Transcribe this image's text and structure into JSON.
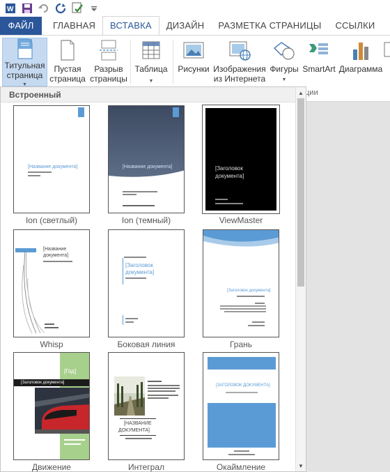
{
  "quick_access": {
    "icons": [
      "word-logo-icon",
      "save-icon",
      "undo-icon",
      "redo-icon",
      "spellcheck-icon",
      "customize-icon"
    ]
  },
  "tabs": [
    {
      "label": "ФАЙЛ"
    },
    {
      "label": "ГЛАВНАЯ"
    },
    {
      "label": "ВСТАВКА"
    },
    {
      "label": "ДИЗАЙН"
    },
    {
      "label": "РАЗМЕТКА СТРАНИЦЫ"
    },
    {
      "label": "ССЫЛКИ"
    }
  ],
  "active_tab": "ВСТАВКА",
  "ribbon": {
    "cover_page": {
      "line1": "Титульная",
      "line2": "страница"
    },
    "blank_page": {
      "line1": "Пустая",
      "line2": "страница"
    },
    "page_break": {
      "line1": "Разрыв",
      "line2": "страницы"
    },
    "table": {
      "line1": "Таблица"
    },
    "pictures": {
      "line1": "Рисунки"
    },
    "online_pictures": {
      "line1": "Изображения",
      "line2": "из Интернета"
    },
    "shapes": {
      "line1": "Фигуры"
    },
    "smartart": {
      "line1": "SmartArt"
    },
    "chart": {
      "line1": "Диаграмма"
    },
    "group_partial": "ции"
  },
  "gallery": {
    "header": "Встроенный",
    "items": [
      {
        "caption": "Ion (светлый)",
        "title": "[Название документа]"
      },
      {
        "caption": "Ion (темный)",
        "title": "[Название документа]"
      },
      {
        "caption": "ViewMaster",
        "title_l1": "[Заголовок",
        "title_l2": "документа]"
      },
      {
        "caption": "Whisp",
        "title_l1": "[Название",
        "title_l2": "документа]"
      },
      {
        "caption": "Боковая линия",
        "title_l1": "[Заголовок",
        "title_l2": "документа]"
      },
      {
        "caption": "Грань",
        "title": "[Заголовок документа]"
      },
      {
        "caption": "Движение",
        "year": "[Год]",
        "title": "[Заголовок документа]"
      },
      {
        "caption": "Интеграл",
        "title_l1": "[НАЗВАНИЕ",
        "title_l2": "ДОКУМЕНТА]"
      },
      {
        "caption": "Окаймление",
        "title": "[ЗАГОЛОВОК ДОКУМЕНТА]"
      }
    ]
  },
  "colors": {
    "file_tab": "#2b579a",
    "accent_blue": "#5b9bd5",
    "selected_button": "#c5daf1"
  }
}
